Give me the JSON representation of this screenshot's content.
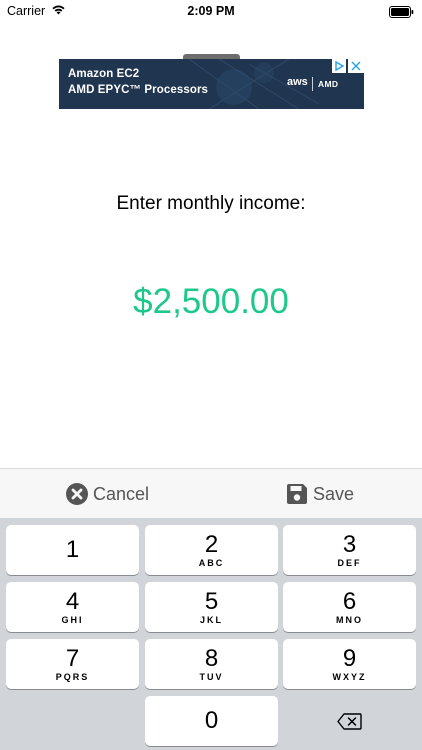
{
  "status_bar": {
    "carrier": "Carrier",
    "time": "2:09 PM",
    "icons": [
      "wifi-icon",
      "battery-icon"
    ]
  },
  "ad": {
    "line1": "Amazon EC2",
    "line2": "AMD EPYC™ Processors",
    "aws_logo": "aws",
    "amd_logo": "AMD",
    "icons": [
      "adchoices-icon",
      "close-icon"
    ],
    "background_color": "#1f3550"
  },
  "prompt": "Enter monthly income:",
  "amount": "$2,500.00",
  "amount_color": "#1ec88a",
  "toolbar": {
    "cancel_label": "Cancel",
    "save_label": "Save",
    "icons": [
      "cancel-circle-icon",
      "floppy-disk-icon"
    ]
  },
  "keypad": {
    "keys": [
      {
        "digit": "1",
        "letters": ""
      },
      {
        "digit": "2",
        "letters": "ABC"
      },
      {
        "digit": "3",
        "letters": "DEF"
      },
      {
        "digit": "4",
        "letters": "GHI"
      },
      {
        "digit": "5",
        "letters": "JKL"
      },
      {
        "digit": "6",
        "letters": "MNO"
      },
      {
        "digit": "7",
        "letters": "PQRS"
      },
      {
        "digit": "8",
        "letters": "TUV"
      },
      {
        "digit": "9",
        "letters": "WXYZ"
      },
      {
        "digit": "0",
        "letters": ""
      }
    ],
    "backspace_icon": "backspace-icon"
  }
}
